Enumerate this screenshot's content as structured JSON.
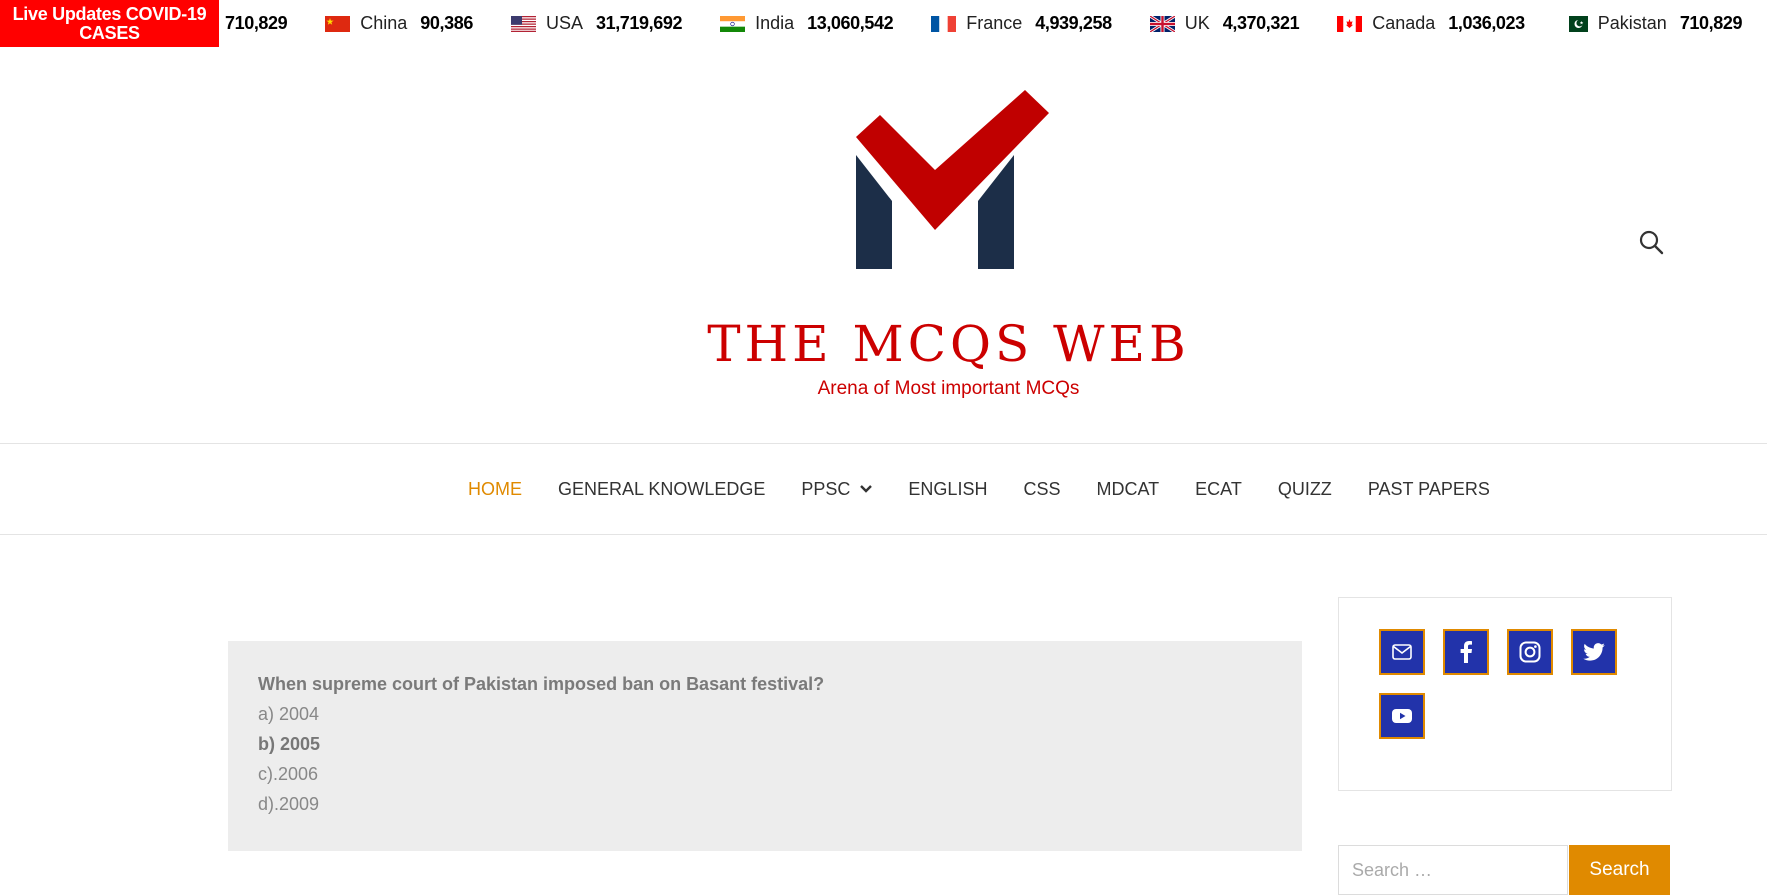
{
  "ticker": {
    "badge": "Live Updates COVID-19 CASES",
    "lead_value": "710,829",
    "items": [
      {
        "country": "China",
        "flag": "china-flag-icon",
        "cases": "90,386"
      },
      {
        "country": "USA",
        "flag": "usa-flag-icon",
        "cases": "31,719,692"
      },
      {
        "country": "India",
        "flag": "india-flag-icon",
        "cases": "13,060,542"
      },
      {
        "country": "France",
        "flag": "france-flag-icon",
        "cases": "4,939,258"
      },
      {
        "country": "UK",
        "flag": "uk-flag-icon",
        "cases": "4,370,321"
      },
      {
        "country": "Canada",
        "flag": "canada-flag-icon",
        "cases": "1,036,023"
      },
      {
        "country": "Pakistan",
        "flag": "pakistan-flag-icon",
        "cases": "710,829"
      }
    ]
  },
  "header": {
    "title": "THE MCQS WEB",
    "tagline": "Arena of Most important MCQs",
    "logo_icon": "mcqs-checkmark-logo",
    "search_icon": "search-icon"
  },
  "nav": {
    "items": [
      {
        "label": "HOME",
        "active": true
      },
      {
        "label": "GENERAL KNOWLEDGE"
      },
      {
        "label": "PPSC",
        "has_dropdown": true
      },
      {
        "label": "ENGLISH"
      },
      {
        "label": "CSS"
      },
      {
        "label": "MDCAT"
      },
      {
        "label": "ECAT"
      },
      {
        "label": "QUIZZ"
      },
      {
        "label": "PAST PAPERS"
      }
    ]
  },
  "question": {
    "text": "When supreme court of Pakistan imposed ban on Basant festival?",
    "options": [
      {
        "text": "a) 2004",
        "correct": false
      },
      {
        "text": "b) 2005",
        "correct": true
      },
      {
        "text": "c).2006",
        "correct": false
      },
      {
        "text": "d).2009",
        "correct": false
      }
    ]
  },
  "sidebar": {
    "social": [
      "email-icon",
      "facebook-icon",
      "instagram-icon",
      "twitter-icon",
      "youtube-icon"
    ],
    "search_placeholder": "Search …",
    "search_button": "Search"
  },
  "colors": {
    "accent": "#e08a00",
    "brand_red": "#cc0000",
    "ticker_red": "#ff0000",
    "logo_navy": "#1c2e48",
    "social_blue": "#2233aa"
  }
}
